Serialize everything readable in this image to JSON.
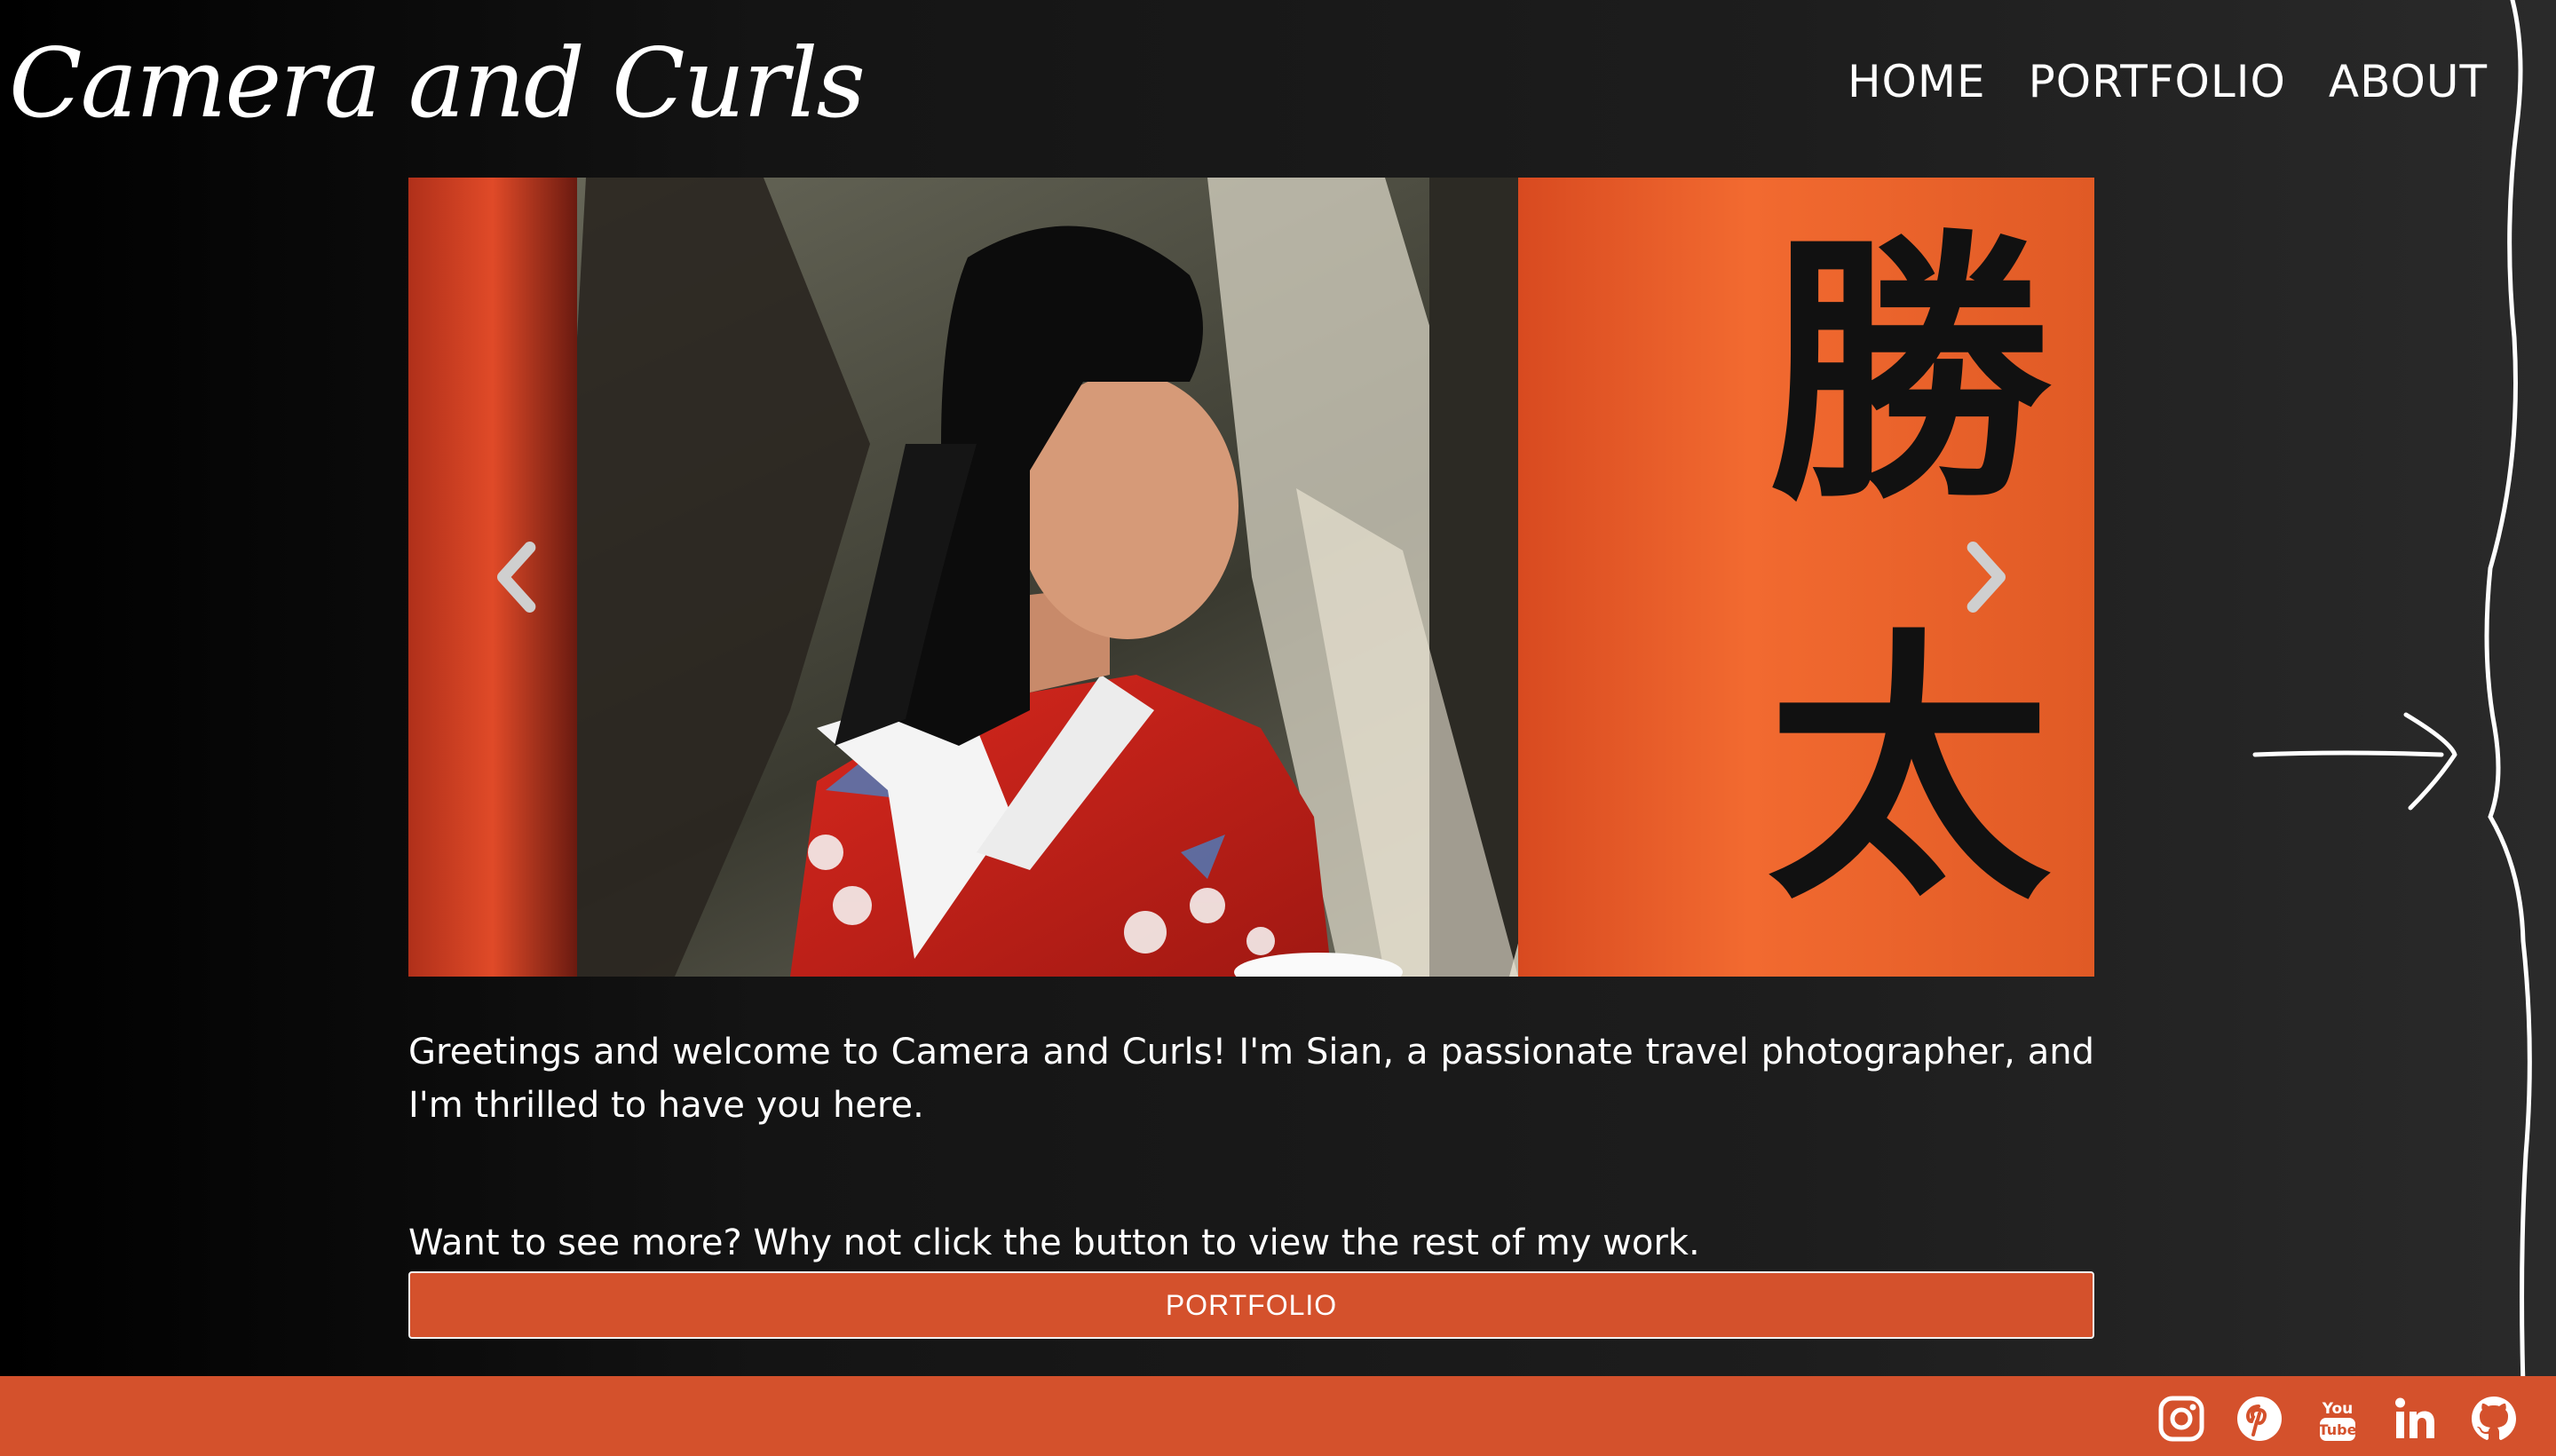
{
  "header": {
    "logo": "Camera and Curls",
    "nav": [
      {
        "label": "HOME"
      },
      {
        "label": "PORTFOLIO"
      },
      {
        "label": "ABOUT"
      }
    ]
  },
  "carousel": {
    "prev_icon": "chevron-left-icon",
    "next_icon": "chevron-right-icon"
  },
  "content": {
    "welcome": "Greetings and welcome to Camera and Curls! I'm Sian, a passionate travel photographer, and I'm thrilled to have you here.",
    "cta": "Want to see more? Why not click the button to view the rest of my work.",
    "button_label": "PORTFOLIO"
  },
  "footer": {
    "social": [
      "instagram-icon",
      "pinterest-icon",
      "youtube-icon",
      "linkedin-icon",
      "github-icon"
    ]
  },
  "colors": {
    "accent": "#d4512c",
    "background_dark": "#000000",
    "background_light": "#2a2a2a",
    "text": "#ffffff"
  }
}
